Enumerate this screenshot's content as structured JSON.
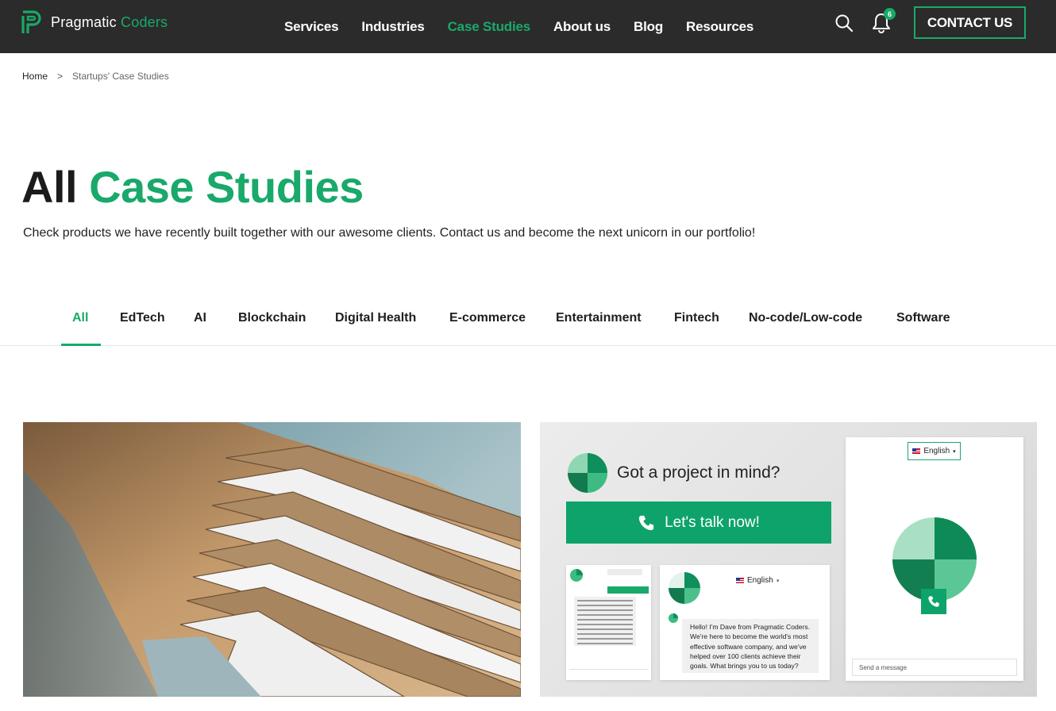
{
  "brand": {
    "name_part1": "Pragmatic ",
    "name_part2": "Coders",
    "accent": "#19a96a",
    "header_bg": "#2b2b2b"
  },
  "nav": {
    "items": [
      {
        "label": "Services",
        "active": false
      },
      {
        "label": "Industries",
        "active": false
      },
      {
        "label": "Case Studies",
        "active": true
      },
      {
        "label": "About us",
        "active": false
      },
      {
        "label": "Blog",
        "active": false
      },
      {
        "label": "Resources",
        "active": false
      }
    ],
    "notification_count": "6",
    "contact_label": "CONTACT US",
    "search_icon": "search-icon",
    "bell_icon": "bell-icon"
  },
  "breadcrumb": {
    "home": "Home",
    "separator": ">",
    "current": "Startups' Case Studies"
  },
  "hero": {
    "title_part1": "All ",
    "title_part2": "Case Studies",
    "subtitle": "Check products we have recently built together with our awesome clients. Contact us and become the next unicorn in our portfolio!"
  },
  "tabs": [
    {
      "label": "All",
      "active": true
    },
    {
      "label": "EdTech",
      "active": false
    },
    {
      "label": "AI",
      "active": false
    },
    {
      "label": "Blockchain",
      "active": false
    },
    {
      "label": "Digital Health",
      "active": false
    },
    {
      "label": "E-commerce",
      "active": false
    },
    {
      "label": "Entertainment",
      "active": false
    },
    {
      "label": "Fintech",
      "active": false
    },
    {
      "label": "No-code/Low-code",
      "active": false
    },
    {
      "label": "Software",
      "active": false
    }
  ],
  "cards": {
    "left_image": "file-folders-photo",
    "right": {
      "cta_title": "Got a project in mind?",
      "cta_button": "Let's talk now!",
      "language": "English",
      "send_placeholder": "Send a message",
      "chat_message": "Hello! I'm Dave from Pragmatic Coders. We're here to become the world's most effective software company, and we've helped over 100 clients achieve their goals. What brings you to us today?"
    }
  }
}
